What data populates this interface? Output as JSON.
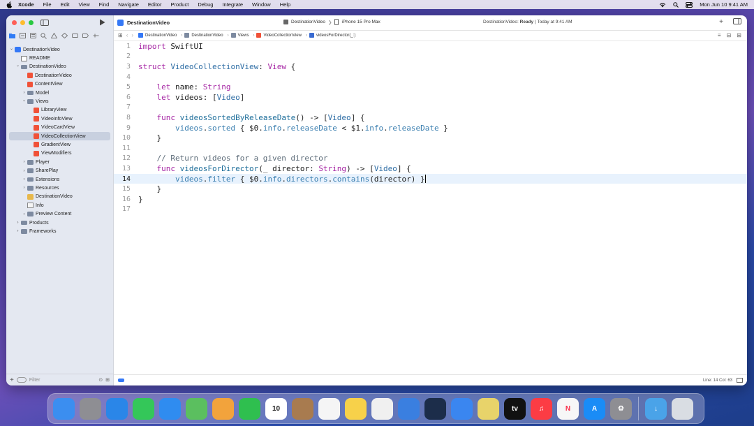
{
  "menubar": {
    "app": "Xcode",
    "items": [
      "File",
      "Edit",
      "View",
      "Find",
      "Navigate",
      "Editor",
      "Product",
      "Debug",
      "Integrate",
      "Window",
      "Help"
    ],
    "datetime": "Mon Jun 10  9:41 AM"
  },
  "toolbar": {
    "project": "DestinationVideo",
    "scheme": "DestinationVideo",
    "device": "iPhone 15 Pro Max",
    "status_prefix": "DestinationVideo: ",
    "status_state": "Ready",
    "status_time": " | Today at 9:41 AM"
  },
  "navigator": {
    "filter_placeholder": "Filter",
    "tree": [
      {
        "label": "DestinationVideo",
        "icon": "project-icon",
        "indent": 0,
        "disclosure": "open"
      },
      {
        "label": "README",
        "icon": "doc-icon",
        "indent": 1,
        "disclosure": ""
      },
      {
        "label": "DestinationVideo",
        "icon": "folder-icon",
        "indent": 1,
        "disclosure": "open"
      },
      {
        "label": "DestinationVideo",
        "icon": "swift-file-icon",
        "indent": 2,
        "disclosure": ""
      },
      {
        "label": "ContentView",
        "icon": "swift-file-icon",
        "indent": 2,
        "disclosure": ""
      },
      {
        "label": "Model",
        "icon": "folder-icon",
        "indent": 2,
        "disclosure": "closed"
      },
      {
        "label": "Views",
        "icon": "folder-icon",
        "indent": 2,
        "disclosure": "open"
      },
      {
        "label": "LibraryView",
        "icon": "swift-file-icon",
        "indent": 3,
        "disclosure": ""
      },
      {
        "label": "VideoInfoView",
        "icon": "swift-file-icon",
        "indent": 3,
        "disclosure": ""
      },
      {
        "label": "VideoCardView",
        "icon": "swift-file-icon",
        "indent": 3,
        "disclosure": ""
      },
      {
        "label": "VideoCollectionView",
        "icon": "swift-file-icon",
        "indent": 3,
        "disclosure": "",
        "selected": true
      },
      {
        "label": "GradientView",
        "icon": "swift-file-icon",
        "indent": 3,
        "disclosure": ""
      },
      {
        "label": "ViewModifiers",
        "icon": "swift-file-icon",
        "indent": 3,
        "disclosure": ""
      },
      {
        "label": "Player",
        "icon": "folder-icon",
        "indent": 2,
        "disclosure": "closed"
      },
      {
        "label": "SharePlay",
        "icon": "folder-icon",
        "indent": 2,
        "disclosure": "closed"
      },
      {
        "label": "Extensions",
        "icon": "folder-icon",
        "indent": 2,
        "disclosure": "closed"
      },
      {
        "label": "Resources",
        "icon": "folder-icon",
        "indent": 2,
        "disclosure": "closed"
      },
      {
        "label": "DestinationVideo",
        "icon": "asset-icon",
        "indent": 2,
        "disclosure": ""
      },
      {
        "label": "Info",
        "icon": "plist-icon",
        "indent": 2,
        "disclosure": ""
      },
      {
        "label": "Preview Content",
        "icon": "folder-icon",
        "indent": 2,
        "disclosure": "closed"
      },
      {
        "label": "Products",
        "icon": "folder-icon",
        "indent": 1,
        "disclosure": "closed"
      },
      {
        "label": "Frameworks",
        "icon": "folder-icon",
        "indent": 1,
        "disclosure": "closed"
      }
    ]
  },
  "jumpbar": {
    "crumbs": [
      "DestinationVideo",
      "DestinationVideo",
      "Views",
      "VideoCollectionView",
      "videosForDirector(_:)"
    ]
  },
  "editor": {
    "current_line": 14,
    "lines": [
      [
        [
          "kw",
          "import"
        ],
        [
          "txt",
          " SwiftUI"
        ]
      ],
      [],
      [
        [
          "kw",
          "struct"
        ],
        [
          "txt",
          " "
        ],
        [
          "ty",
          "VideoCollectionView"
        ],
        [
          "txt",
          ": "
        ],
        [
          "kw",
          "View"
        ],
        [
          "txt",
          " {"
        ]
      ],
      [],
      [
        [
          "txt",
          "    "
        ],
        [
          "kw",
          "let"
        ],
        [
          "txt",
          " name: "
        ],
        [
          "kw",
          "String"
        ]
      ],
      [
        [
          "txt",
          "    "
        ],
        [
          "kw",
          "let"
        ],
        [
          "txt",
          " videos: ["
        ],
        [
          "ty",
          "Video"
        ],
        [
          "txt",
          "]"
        ]
      ],
      [],
      [
        [
          "txt",
          "    "
        ],
        [
          "kw",
          "func"
        ],
        [
          "txt",
          " "
        ],
        [
          "fn",
          "videosSortedByReleaseDate"
        ],
        [
          "txt",
          "() -> ["
        ],
        [
          "ty",
          "Video"
        ],
        [
          "txt",
          "] {"
        ]
      ],
      [
        [
          "txt",
          "        "
        ],
        [
          "prop",
          "videos"
        ],
        [
          "txt",
          "."
        ],
        [
          "prop",
          "sorted"
        ],
        [
          "txt",
          " { $0."
        ],
        [
          "prop",
          "info"
        ],
        [
          "txt",
          "."
        ],
        [
          "prop",
          "releaseDate"
        ],
        [
          "txt",
          " < $1."
        ],
        [
          "prop",
          "info"
        ],
        [
          "txt",
          "."
        ],
        [
          "prop",
          "releaseDate"
        ],
        [
          "txt",
          " }"
        ]
      ],
      [
        [
          "txt",
          "    }"
        ]
      ],
      [],
      [
        [
          "cm",
          "    // Return videos for a given director"
        ]
      ],
      [
        [
          "txt",
          "    "
        ],
        [
          "kw",
          "func"
        ],
        [
          "txt",
          " "
        ],
        [
          "fn",
          "videosForDirector"
        ],
        [
          "txt",
          "(_ director: "
        ],
        [
          "kw",
          "String"
        ],
        [
          "txt",
          ") -> ["
        ],
        [
          "ty",
          "Video"
        ],
        [
          "txt",
          "] {"
        ]
      ],
      [
        [
          "txt",
          "        "
        ],
        [
          "prop",
          "videos"
        ],
        [
          "txt",
          "."
        ],
        [
          "prop",
          "filter"
        ],
        [
          "txt",
          " { $0."
        ],
        [
          "prop",
          "info"
        ],
        [
          "txt",
          "."
        ],
        [
          "prop",
          "directors"
        ],
        [
          "txt",
          "."
        ],
        [
          "prop",
          "contains"
        ],
        [
          "txt",
          "(director) }"
        ]
      ],
      [
        [
          "txt",
          "    }"
        ]
      ],
      [
        [
          "txt",
          "}"
        ]
      ],
      []
    ]
  },
  "statusbar": {
    "position": "Line: 14  Col: 63"
  },
  "dock": {
    "apps": [
      {
        "name": "finder",
        "color": "#3b8ef0",
        "glyph": ""
      },
      {
        "name": "launchpad",
        "color": "#8e8e93",
        "glyph": ""
      },
      {
        "name": "safari",
        "color": "#2a86e8",
        "glyph": ""
      },
      {
        "name": "messages",
        "color": "#34c759",
        "glyph": ""
      },
      {
        "name": "mail",
        "color": "#2f8cf0",
        "glyph": ""
      },
      {
        "name": "maps",
        "color": "#5bbf5f",
        "glyph": ""
      },
      {
        "name": "photos",
        "color": "#f2a33c",
        "glyph": ""
      },
      {
        "name": "facetime",
        "color": "#2fbf4f",
        "glyph": ""
      },
      {
        "name": "calendar",
        "color": "#ffffff",
        "glyph": "10",
        "glyph_color": "#222"
      },
      {
        "name": "contacts",
        "color": "#a87b4f",
        "glyph": ""
      },
      {
        "name": "reminders",
        "color": "#f5f5f5",
        "glyph": ""
      },
      {
        "name": "notes",
        "color": "#f7d14a",
        "glyph": ""
      },
      {
        "name": "freeform",
        "color": "#f0f0f0",
        "glyph": ""
      },
      {
        "name": "xcode",
        "color": "#3a7fe0",
        "glyph": ""
      },
      {
        "name": "instruments",
        "color": "#1c2d4a",
        "glyph": ""
      },
      {
        "name": "simulator",
        "color": "#3a86f0",
        "glyph": ""
      },
      {
        "name": "reality-composer",
        "color": "#e8d36a",
        "glyph": ""
      },
      {
        "name": "tv",
        "color": "#111111",
        "glyph": "tv"
      },
      {
        "name": "music",
        "color": "#fc3c44",
        "glyph": "♫"
      },
      {
        "name": "news",
        "color": "#f7f7f7",
        "glyph": "N",
        "glyph_color": "#fa2d48"
      },
      {
        "name": "app-store",
        "color": "#1a8cf6",
        "glyph": "A"
      },
      {
        "name": "system-settings",
        "color": "#8e8e93",
        "glyph": "⚙"
      },
      {
        "name": "downloads",
        "color": "#4aa3e8",
        "glyph": "↓"
      },
      {
        "name": "trash",
        "color": "#d9dde3",
        "glyph": ""
      }
    ]
  }
}
